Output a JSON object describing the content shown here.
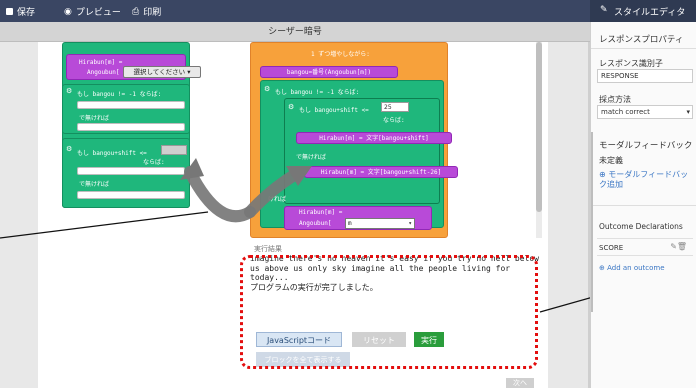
{
  "topbar": {
    "save": "保存",
    "preview": "プレビュー",
    "print": "印刷"
  },
  "panel_header": {
    "title": "スタイルエディタ"
  },
  "subbar": {
    "title": "シーザー暗号"
  },
  "panel": {
    "section_title": "レスポンスプロパティ",
    "response_id_label": "レスポンス識別子",
    "response_id_value": "RESPONSE",
    "scoring_label": "採点方法",
    "scoring_value": "match correct",
    "modal_feedback_label": "モーダルフィードバック",
    "undefined_label": "未定義",
    "add_modal_feedback": "⊕ モーダルフィードバック追加",
    "outcome_title": "Outcome Declarations",
    "score_label": "SCORE",
    "add_outcome": "⊕ Add an outcome"
  },
  "blocks": {
    "hirabun_assign": "Hirabun[m] =",
    "angoubun": "Angoubun[",
    "select_placeholder": "選択してください",
    "if1": "もし bangou != -1 ならば:",
    "else1": "で無ければ",
    "if2": "もし bangou+shift <=",
    "if2_suffix": "ならば:",
    "else2": "で無ければ",
    "loop_label": "1 ずつ増やしながら:",
    "bangou_line": "bangou=番号(Angoubun[m])",
    "if3": "もし bangou != -1 ならば:",
    "if4": "もし bangou+shift <=",
    "if4_value": "25",
    "if4_suffix": "ならば:",
    "hirabun_eq_moji": "Hirabun[m] = 文字[bangou+shift]",
    "else4": "で無ければ",
    "hirabun_eq_moji26": "Hirabun[m] = 文字[bangou+shift-26]",
    "else3": "ければ",
    "hirabun_assign2": "Hirabun[m] =",
    "angoubun2": "Angoubun[",
    "m_select": "m"
  },
  "result": {
    "label": "実行結果",
    "output": "imagine there's no heaven it's easy if you try no hell below\nus above us only sky imagine all the people living for\ntoday...\nプログラムの実行が完了しました。"
  },
  "buttons": {
    "js_code": "JavaScriptコード",
    "reset": "リセット",
    "run": "実行",
    "extra": "ブロックを全て表示する"
  },
  "footer": {
    "next": "次へ"
  }
}
